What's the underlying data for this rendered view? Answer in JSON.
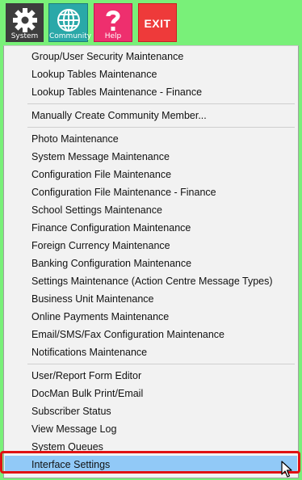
{
  "toolbar": {
    "system_label": "System",
    "community_label": "Community",
    "help_label": "Help",
    "exit_label": "EXIT",
    "icons": {
      "system": "gear-icon",
      "community": "globe-icon",
      "help": "question-icon"
    },
    "colors": {
      "system": "#3d3d3d",
      "community": "#2aa8a8",
      "help": "#ee2f6e",
      "exit": "#ee3a3a",
      "background": "#79f079"
    }
  },
  "menu": {
    "items": [
      "Group/User Security Maintenance",
      "Lookup Tables Maintenance",
      "Lookup Tables Maintenance - Finance",
      "Manually Create Community Member...",
      "Photo Maintenance",
      "System Message Maintenance",
      "Configuration File Maintenance",
      "Configuration File Maintenance - Finance",
      "School Settings Maintenance",
      "Finance Configuration Maintenance",
      "Foreign Currency Maintenance",
      "Banking Configuration Maintenance",
      "Settings Maintenance (Action Centre Message Types)",
      "Business Unit Maintenance",
      "Online Payments Maintenance",
      "Email/SMS/Fax Configuration Maintenance",
      "Notifications Maintenance",
      "User/Report Form Editor",
      "DocMan Bulk Print/Email",
      "Subscriber Status",
      "View Message Log",
      "System Queues",
      "Interface Settings"
    ],
    "highlighted_item": "Interface Settings"
  }
}
